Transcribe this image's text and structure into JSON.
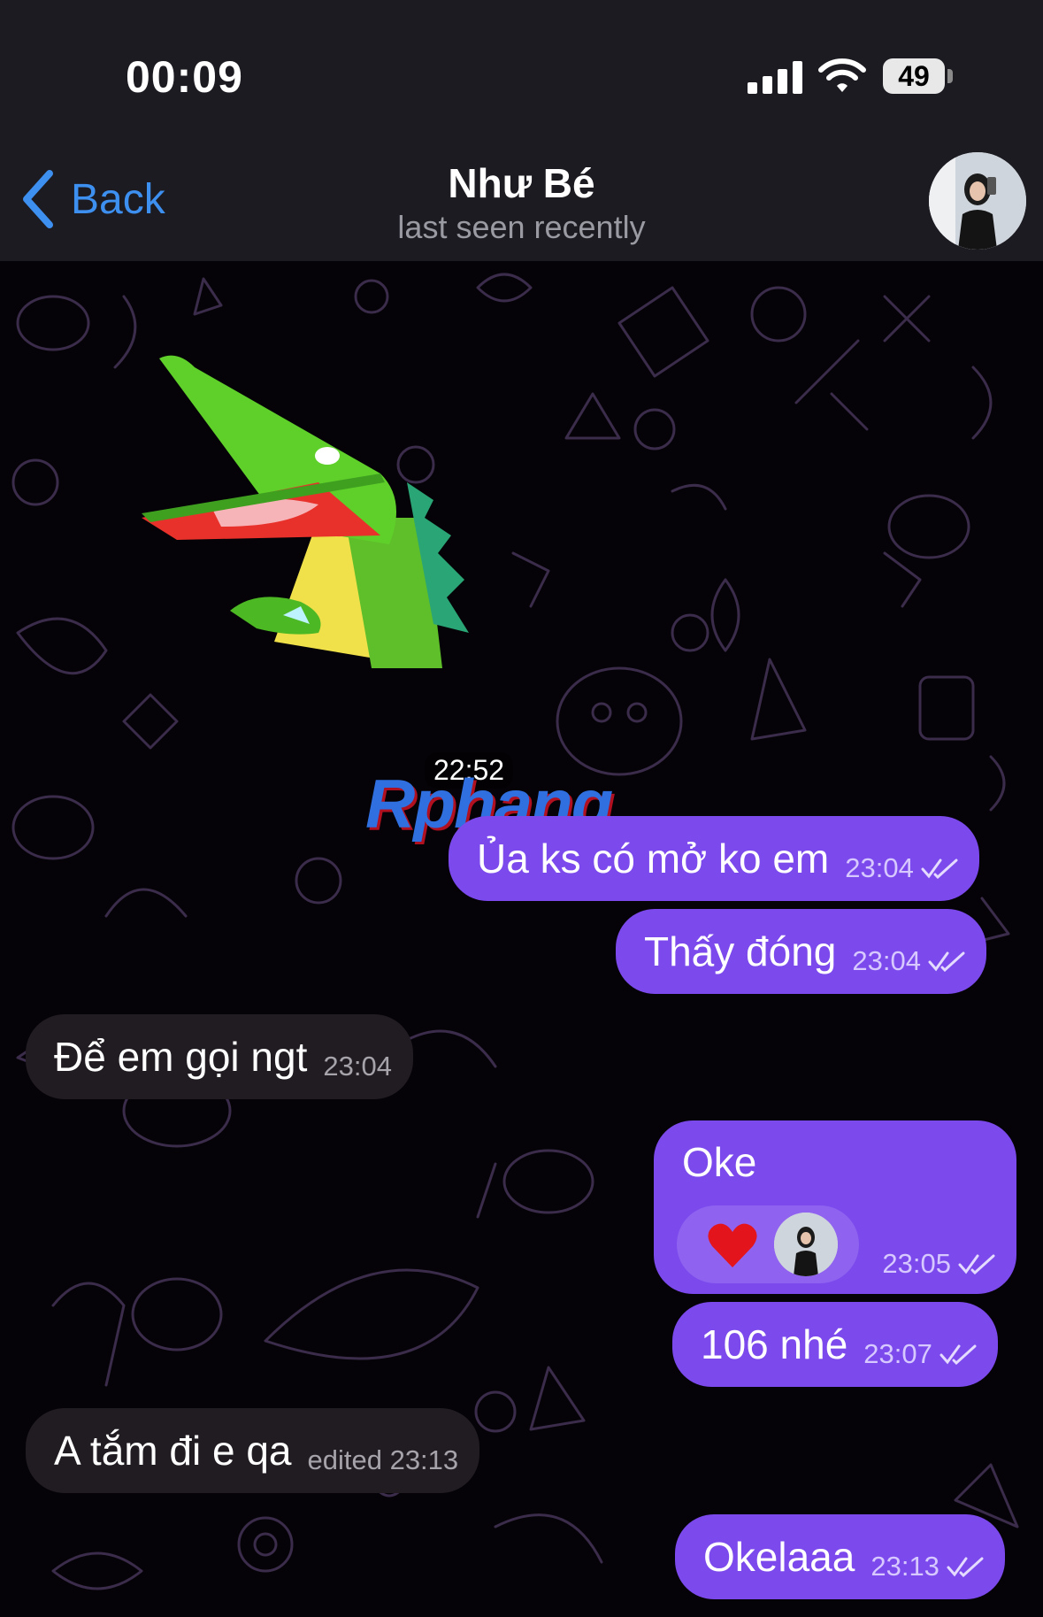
{
  "status_bar": {
    "time": "00:09",
    "battery": "49",
    "icons": [
      "cellular-signal-icon",
      "wifi-icon",
      "battery-icon"
    ]
  },
  "header": {
    "back_label": "Back",
    "title": "Như Bé",
    "subtitle": "last seen recently"
  },
  "sticker": {
    "description_icon": "crocodile-sticker",
    "time": "22:52"
  },
  "watermark": "Rphang",
  "messages": [
    {
      "direction": "out",
      "text": "Ủa ks có mở ko em",
      "time": "23:04",
      "status": "read"
    },
    {
      "direction": "out",
      "text": "Thấy đóng",
      "time": "23:04",
      "status": "read"
    },
    {
      "direction": "in",
      "text": "Để em gọi ngt",
      "time": "23:04"
    },
    {
      "direction": "out",
      "text": "Oke",
      "time": "23:05",
      "status": "read",
      "reaction": "❤️"
    },
    {
      "direction": "out",
      "text": "106 nhé",
      "time": "23:07",
      "status": "read"
    },
    {
      "direction": "in",
      "text": "A tắm đi e qa",
      "time": "edited 23:13"
    },
    {
      "direction": "out",
      "text": "Okelaaa",
      "time": "23:13",
      "status": "read"
    }
  ],
  "colors": {
    "accent": "#3d8ff0",
    "outgoing_bubble": "#7b49ec",
    "incoming_bubble": "#211c22",
    "header_bg": "#1c1b21"
  }
}
